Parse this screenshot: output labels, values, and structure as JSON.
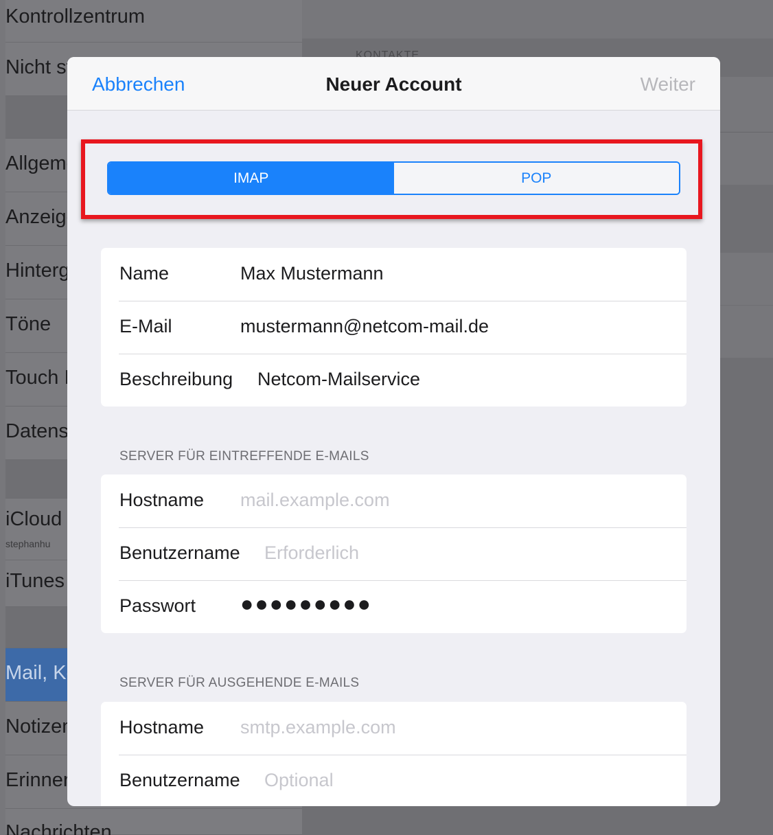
{
  "background": {
    "sidebar_items": [
      {
        "label": "Kontrollzentrum"
      },
      {
        "label": "Nicht stören"
      },
      {
        "label": "Allgemein"
      },
      {
        "label": "Anzeige & Helligkeit"
      },
      {
        "label": "Hintergrundbild"
      },
      {
        "label": "Töne"
      },
      {
        "label": "Touch ID & Code"
      },
      {
        "label": "Datenschutz"
      },
      {
        "label": "iCloud",
        "sublabel": "stephanhu"
      },
      {
        "label": "iTunes & App Store"
      },
      {
        "label": "Mail, Kontakte, Kalender"
      },
      {
        "label": "Notizen"
      },
      {
        "label": "Erinnerungen"
      },
      {
        "label": "Nachrichten"
      }
    ],
    "right_header": "KONTAKTE"
  },
  "modal": {
    "cancel_label": "Abbrechen",
    "title": "Neuer Account",
    "next_label": "Weiter",
    "segments": [
      {
        "label": "IMAP",
        "selected": true
      },
      {
        "label": "POP",
        "selected": false
      }
    ],
    "account": [
      {
        "label": "Name",
        "value": "Max Mustermann"
      },
      {
        "label": "E-Mail",
        "value": "mustermann@netcom-mail.de"
      },
      {
        "label": "Beschreibung",
        "value": "Netcom-Mailservice"
      }
    ],
    "incoming": {
      "header": "SERVER FÜR EINTREFFENDE E-MAILS",
      "hostname_label": "Hostname",
      "hostname_placeholder": "mail.example.com",
      "username_label": "Benutzername",
      "username_placeholder": "Erforderlich",
      "password_label": "Passwort",
      "password_value": "●●●●●●●●●"
    },
    "outgoing": {
      "header": "SERVER FÜR AUSGEHENDE E-MAILS",
      "hostname_label": "Hostname",
      "hostname_placeholder": "smtp.example.com",
      "username_label": "Benutzername",
      "username_placeholder": "Optional"
    }
  },
  "colors": {
    "accent": "#1a82fb",
    "highlight_border": "#e8171f",
    "placeholder": "#c7c7cd"
  }
}
